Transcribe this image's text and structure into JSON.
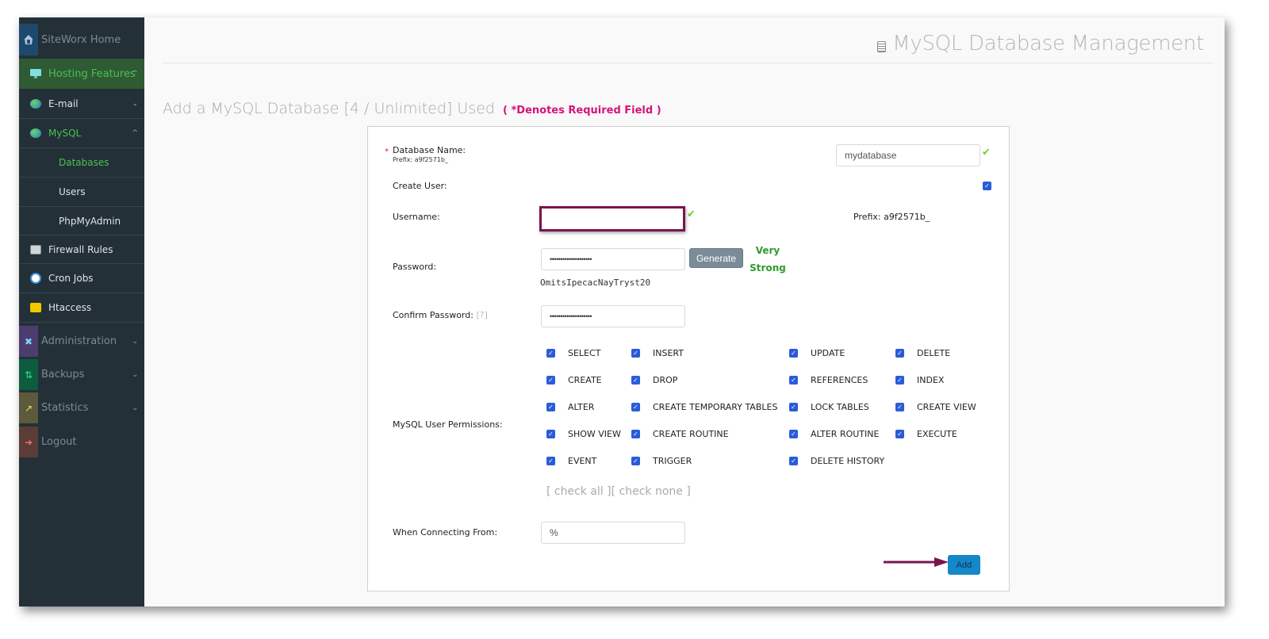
{
  "sidebar": {
    "home": {
      "label": "SiteWorx Home",
      "icon": "home-icon"
    },
    "hosting": {
      "label": "Hosting Features",
      "icon": "monitor-icon",
      "expanded": true
    },
    "items": [
      {
        "label": "E-mail",
        "icon": "email-icon",
        "chevron": "chevron-down"
      },
      {
        "label": "MySQL",
        "icon": "database-icon",
        "chevron": "chevron-up",
        "active": true
      },
      {
        "label": "Databases",
        "active": true
      },
      {
        "label": "Users"
      },
      {
        "label": "PhpMyAdmin"
      },
      {
        "label": "Firewall Rules",
        "icon": "terminal-icon"
      },
      {
        "label": "Cron Jobs",
        "icon": "clock-icon"
      },
      {
        "label": "Htaccess",
        "icon": "folder-icon"
      }
    ],
    "sections": [
      {
        "label": "Administration",
        "icon": "tools-icon",
        "color": "#4b3e6e"
      },
      {
        "label": "Backups",
        "icon": "backup-arrows-icon",
        "color": "#0d5c40"
      },
      {
        "label": "Statistics",
        "icon": "chart-icon",
        "color": "#5c5a3c"
      },
      {
        "label": "Logout",
        "icon": "logout-icon",
        "color": "#5b3c36"
      }
    ]
  },
  "header": {
    "title": "MySQL Database Management",
    "icon": "database-icon"
  },
  "section": {
    "title": "Add a MySQL Database [4 / Unlimited] Used",
    "required_note": "( *Denotes Required Field )"
  },
  "form": {
    "database_name": {
      "label": "Database Name:",
      "prefix": "Prefix: a9f2571b_",
      "value": "mydatabase",
      "required_mark": "*"
    },
    "create_user": {
      "label": "Create User:",
      "checked": true
    },
    "username": {
      "label": "Username:",
      "value": "",
      "prefix": "Prefix: a9f2571b_"
    },
    "password": {
      "label": "Password:",
      "masked": "••••••••••••••••••••",
      "generate_label": "Generate",
      "strength_line1": "Very",
      "strength_line2": "Strong",
      "generated": "OmitsIpecacNayTryst20"
    },
    "confirm_password": {
      "label": "Confirm Password:",
      "help": "[?]",
      "masked": "••••••••••••••••••••"
    },
    "permissions": {
      "label": "MySQL User Permissions:",
      "rows": [
        [
          "SELECT",
          "INSERT",
          "UPDATE",
          "DELETE"
        ],
        [
          "CREATE",
          "DROP",
          "REFERENCES",
          "INDEX"
        ],
        [
          "ALTER",
          "CREATE TEMPORARY TABLES",
          "LOCK TABLES",
          "CREATE VIEW"
        ],
        [
          "SHOW VIEW",
          "CREATE ROUTINE",
          "ALTER ROUTINE",
          "EXECUTE"
        ],
        [
          "EVENT",
          "TRIGGER",
          "DELETE HISTORY"
        ]
      ],
      "check_all": "[ check all ]",
      "check_none": "[ check none ]"
    },
    "connecting_from": {
      "label": "When Connecting From:",
      "value": "%"
    },
    "submit_label": "Add"
  },
  "colors": {
    "accent_green": "#4cc24c",
    "required_pink": "#d6137a",
    "checkbox_blue": "#2a5cd9",
    "add_button": "#1488c8",
    "annotation": "#7a1450"
  }
}
